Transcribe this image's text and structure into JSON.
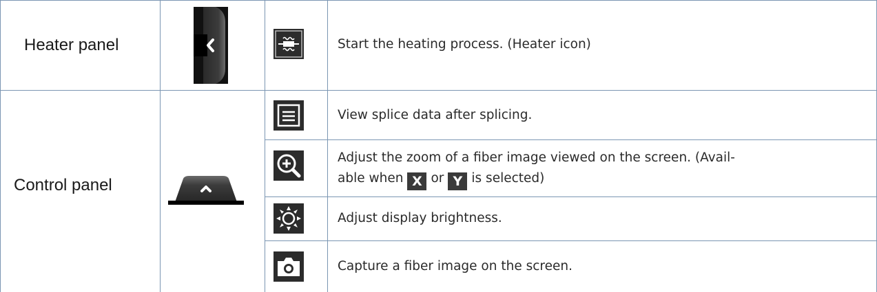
{
  "rows": {
    "heater": {
      "label": "Heater panel",
      "tab_icon": "chevron-left-tab-icon",
      "button_icon": "heater-icon",
      "description": "Start the heating process. (Heater icon)"
    },
    "control": {
      "label": "Control panel",
      "tab_icon": "chevron-up-tab-icon",
      "items": [
        {
          "icon": "splice-data-icon",
          "description": "View splice data after splicing."
        },
        {
          "icon": "zoom-icon",
          "line1": "Adjust the zoom of a fiber image viewed on the screen. (Avail-",
          "line2_before": "able when",
          "key_x": "X",
          "line2_or": "or",
          "key_y": "Y",
          "line2_after": "is selected)"
        },
        {
          "icon": "brightness-icon",
          "description": "Adjust display brightness."
        },
        {
          "icon": "camera-icon",
          "description": "Capture a fiber image on the screen."
        }
      ]
    }
  },
  "colors": {
    "border": "#7a95b2",
    "icon_bg": "#2c2c2c",
    "text": "#2a2a2a"
  }
}
